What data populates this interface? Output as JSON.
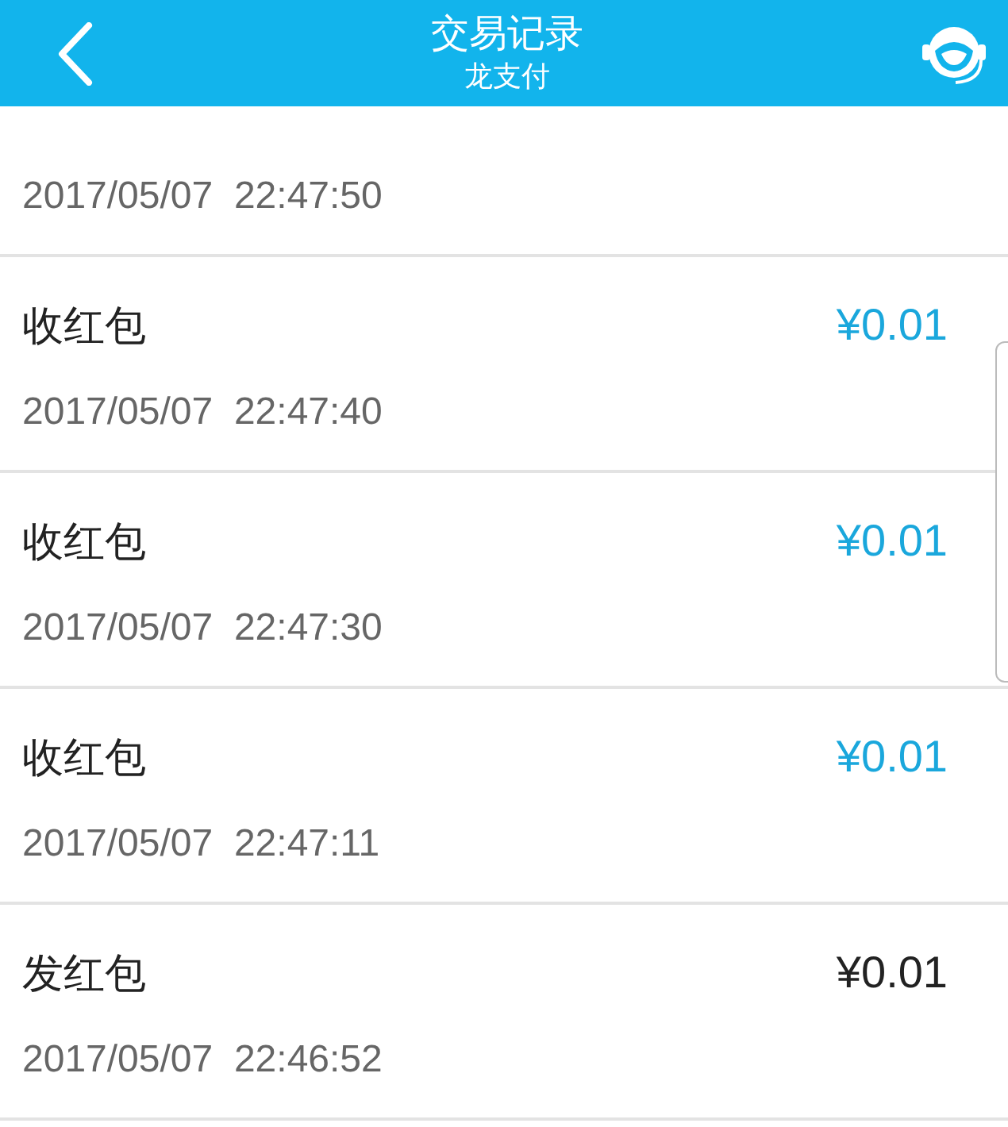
{
  "header": {
    "title": "交易记录",
    "subtitle": "龙支付"
  },
  "records": [
    {
      "time": "2017/05/07  22:47:50"
    },
    {
      "title": "收红包",
      "amount": "¥0.01",
      "kind": "income",
      "time": "2017/05/07  22:47:40"
    },
    {
      "title": "收红包",
      "amount": "¥0.01",
      "kind": "income",
      "time": "2017/05/07  22:47:30"
    },
    {
      "title": "收红包",
      "amount": "¥0.01",
      "kind": "income",
      "time": "2017/05/07  22:47:11"
    },
    {
      "title": "发红包",
      "amount": "¥0.01",
      "kind": "expense",
      "time": "2017/05/07  22:46:52"
    }
  ]
}
